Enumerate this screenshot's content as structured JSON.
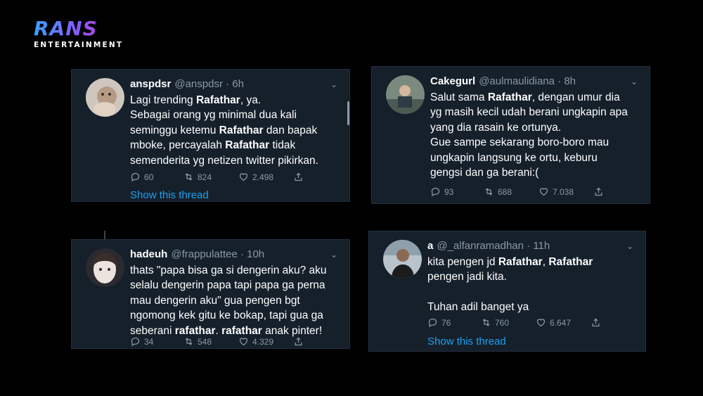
{
  "logo": {
    "word": "RANS",
    "sub": "ENTERTAINMENT"
  },
  "tweets": [
    {
      "name": "anspdsr",
      "handle": "@anspdsr · 6h",
      "lines": [
        [
          {
            "t": "Lagi trending "
          },
          {
            "t": "Rafathar",
            "b": true
          },
          {
            "t": ", ya."
          }
        ],
        [
          {
            "t": "Sebagai orang yg minimal dua kali"
          }
        ],
        [
          {
            "t": "seminggu ketemu "
          },
          {
            "t": "Rafathar",
            "b": true
          },
          {
            "t": " dan bapak"
          }
        ],
        [
          {
            "t": "mboke, percayalah "
          },
          {
            "t": "Rafathar",
            "b": true
          },
          {
            "t": " tidak"
          }
        ],
        [
          {
            "t": "semenderita yg netizen twitter pikirkan."
          }
        ]
      ],
      "replies": "60",
      "retweets": "824",
      "likes": "2.498",
      "thread": "Show this thread"
    },
    {
      "name": "Cakegurl",
      "handle": "@aulmaulidiana · 8h",
      "lines": [
        [
          {
            "t": "Salut sama "
          },
          {
            "t": "Rafathar",
            "b": true
          },
          {
            "t": ", dengan umur dia"
          }
        ],
        [
          {
            "t": "yg masih kecil udah berani ungkapin apa"
          }
        ],
        [
          {
            "t": "yang dia rasain ke ortunya."
          }
        ],
        [
          {
            "t": "Gue sampe sekarang boro-boro mau"
          }
        ],
        [
          {
            "t": "ungkapin langsung ke ortu, keburu"
          }
        ],
        [
          {
            "t": "gengsi dan ga berani:("
          }
        ]
      ],
      "replies": "93",
      "retweets": "688",
      "likes": "7.038"
    },
    {
      "name": "hadeuh",
      "handle": "@frappulattee · 10h",
      "lines": [
        [
          {
            "t": "thats \"papa bisa ga si dengerin aku? aku"
          }
        ],
        [
          {
            "t": "selalu dengerin papa tapi papa ga perna"
          }
        ],
        [
          {
            "t": "mau dengerin aku\" gua pengen bgt"
          }
        ],
        [
          {
            "t": "ngomong kek gitu ke bokap, tapi gua ga"
          }
        ],
        [
          {
            "t": "seberani "
          },
          {
            "t": "rafathar",
            "b": true
          },
          {
            "t": ". "
          },
          {
            "t": "rafathar",
            "b": true
          },
          {
            "t": " anak pinter!"
          }
        ]
      ],
      "replies": "34",
      "retweets": "548",
      "likes": "4.329"
    },
    {
      "name": "a",
      "handle": "@_alfanramadhan · 11h",
      "lines": [
        [
          {
            "t": "kita pengen jd "
          },
          {
            "t": "Rafathar",
            "b": true
          },
          {
            "t": ", "
          },
          {
            "t": "Rafathar",
            "b": true
          }
        ],
        [
          {
            "t": "pengen jadi kita."
          }
        ],
        [
          {
            "t": ""
          }
        ],
        [
          {
            "t": "Tuhan adil banget ya"
          }
        ]
      ],
      "replies": "76",
      "retweets": "760",
      "likes": "6.647",
      "thread": "Show this thread"
    }
  ],
  "icons": {
    "reply": "reply-icon",
    "retweet": "retweet-icon",
    "like": "heart-icon",
    "share": "share-icon",
    "more": "chevron-down-icon"
  },
  "colors": {
    "card_bg": "#15202b",
    "muted": "#8899a6",
    "link": "#1da1f2"
  }
}
